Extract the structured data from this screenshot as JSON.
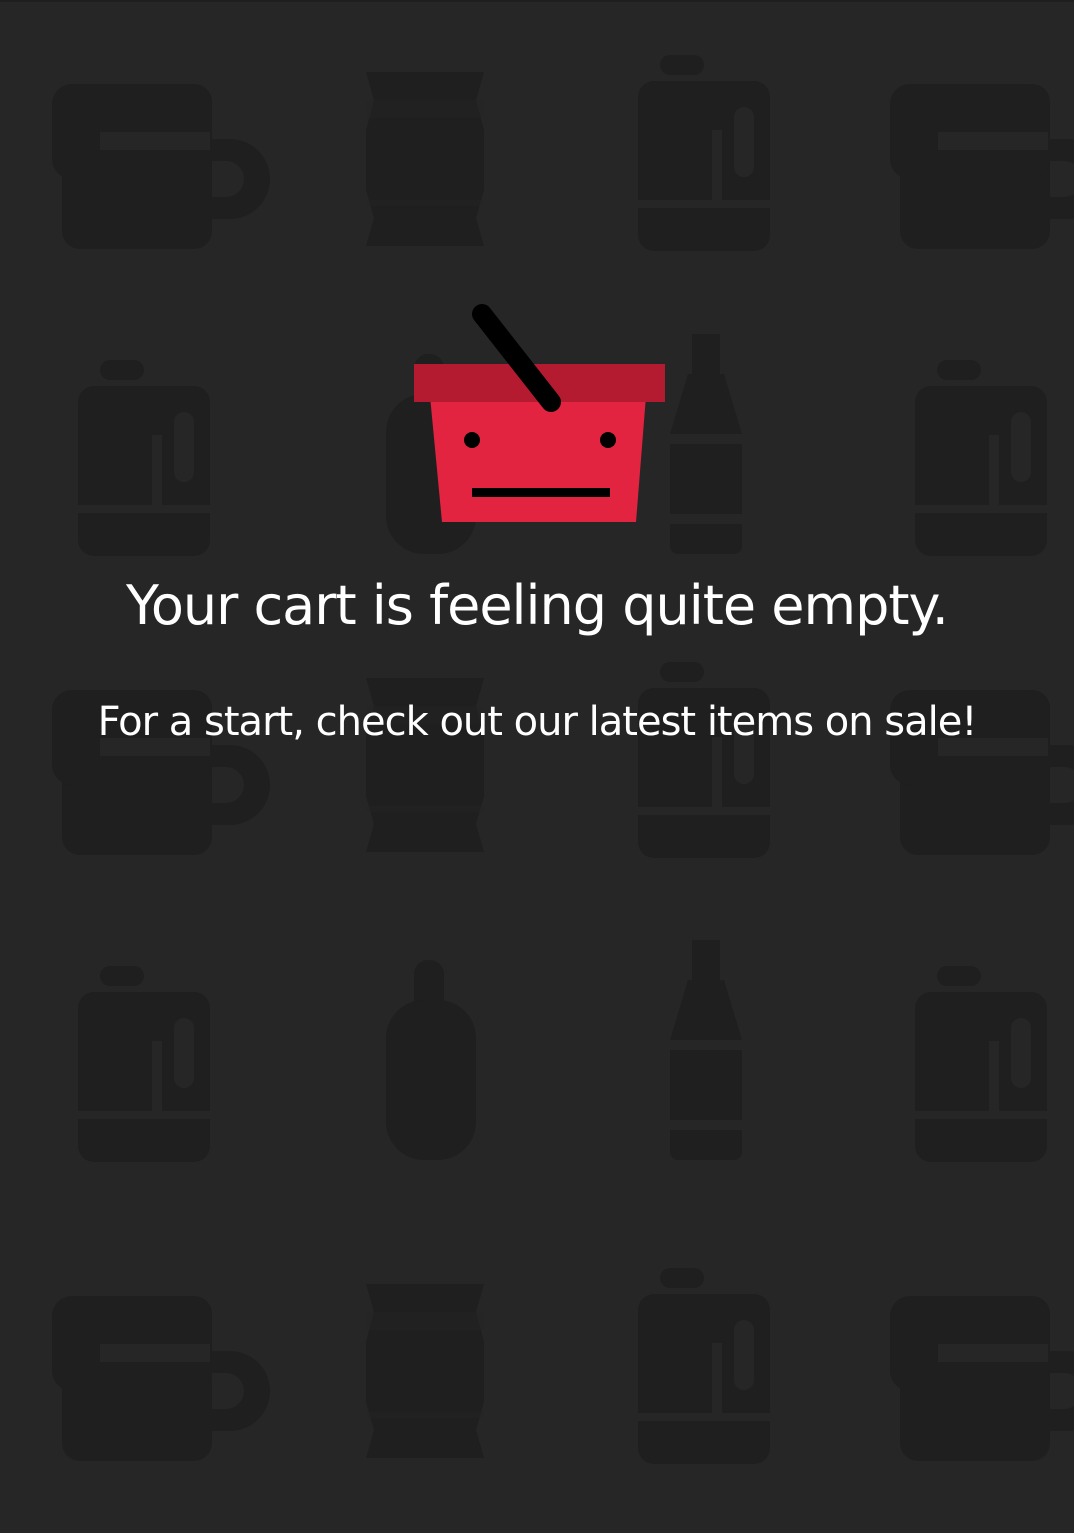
{
  "colors": {
    "background": "#262626",
    "pattern": "#1f1f1f",
    "basket_body": "#e22440",
    "basket_rim": "#b51b30",
    "basket_handle": "#000000",
    "text": "#ffffff"
  },
  "background_icons": [
    "mug-icon",
    "paper-cup-icon",
    "jug-icon",
    "bottle-icon",
    "spray-can-icon"
  ],
  "empty_cart": {
    "icon": "sad-basket-icon",
    "title": "Your cart is feeling quite empty.",
    "subtitle": "For a start, check out our latest items on sale!"
  }
}
